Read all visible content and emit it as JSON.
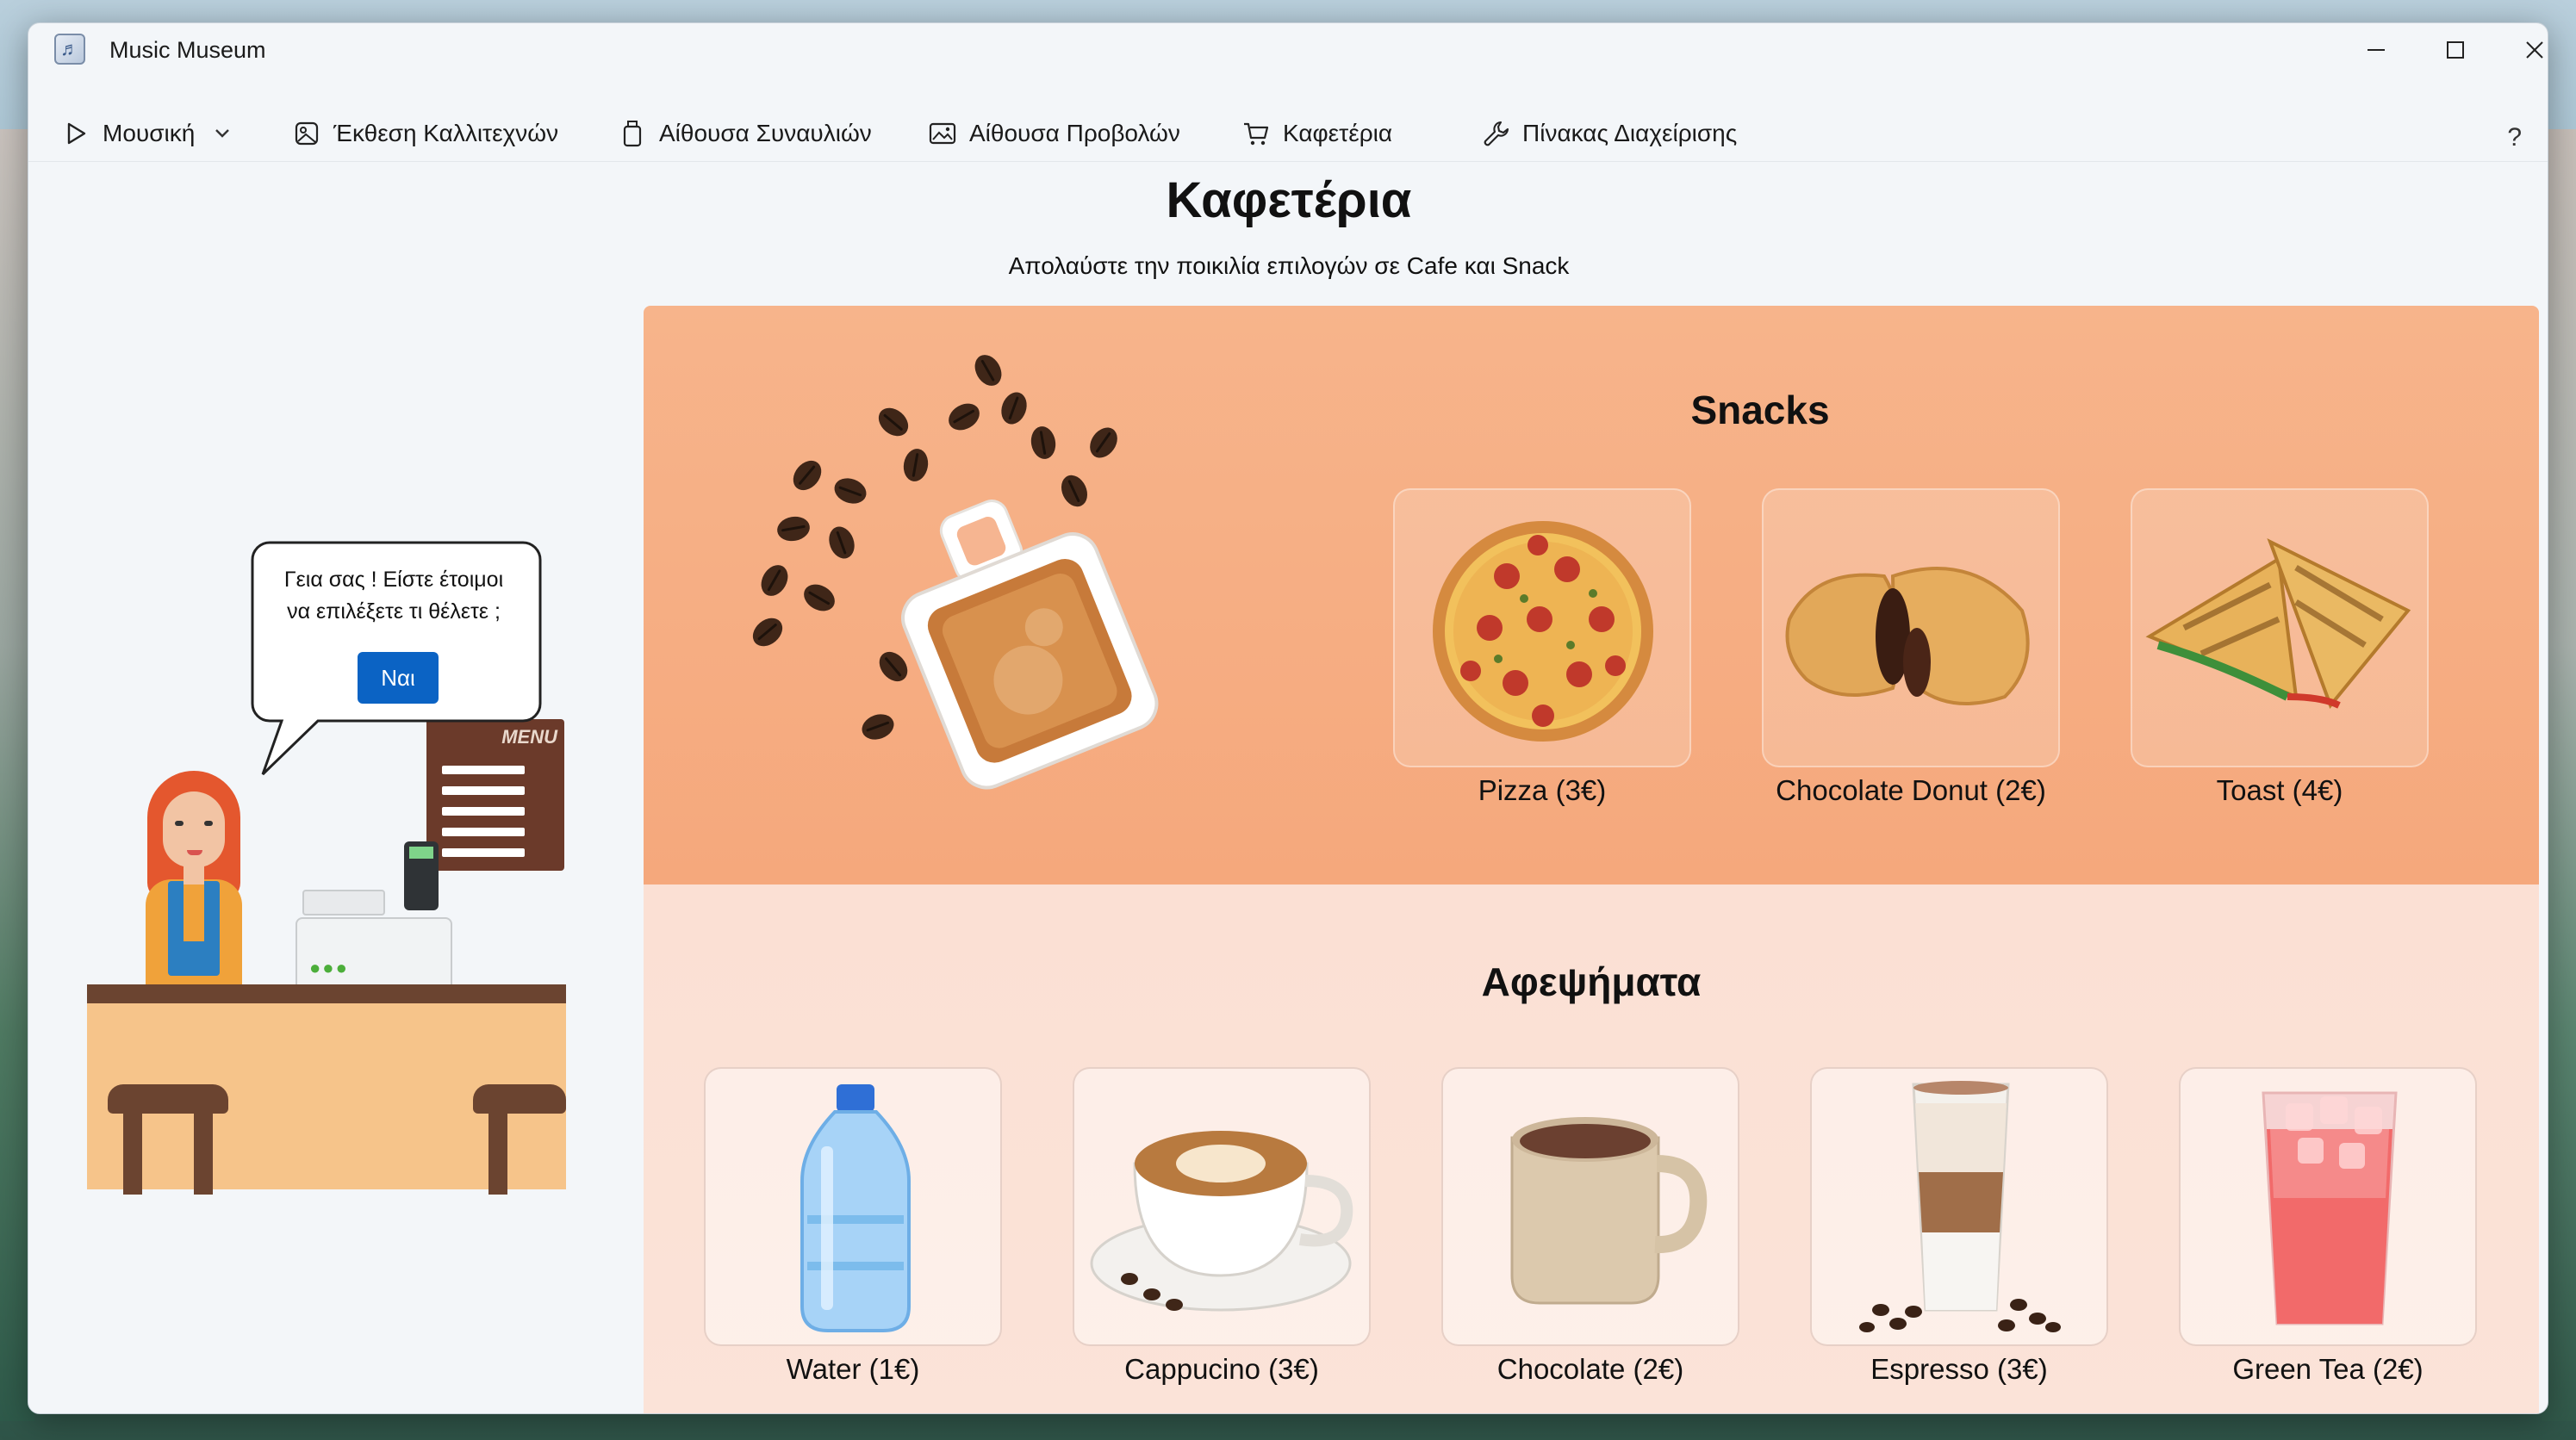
{
  "window": {
    "title": "Music Museum",
    "controls": {
      "minimize": "—",
      "maximize": "☐",
      "close": "✕"
    }
  },
  "nav": {
    "items": [
      {
        "label": "Μουσική",
        "icon": "play-icon"
      },
      {
        "label": "Έκθεση Καλλιτεχνών",
        "icon": "image-icon"
      },
      {
        "label": "Αίθουσα Συναυλιών",
        "icon": "jar-icon"
      },
      {
        "label": "Αίθουσα Προβολών",
        "icon": "gallery-icon"
      },
      {
        "label": "Καφετέρια",
        "icon": "cart-icon",
        "selected": true
      },
      {
        "label": "Πίνακας Διαχείρισης",
        "icon": "wrench-icon"
      }
    ],
    "help": "?"
  },
  "page": {
    "title": "Καφετέρια",
    "subtitle": "Απολαύστε την ποικιλία επιλογών σε Cafe και Snack"
  },
  "greeting": {
    "line1": "Γεια σας ! Είστε έτοιμοι",
    "line2": "να επιλέξετε τι θέλετε ;",
    "button": "Ναι",
    "menu_board": "MENU"
  },
  "snacks": {
    "title": "Snacks",
    "items": [
      {
        "label": "Pizza (3€)",
        "icon": "pizza-icon"
      },
      {
        "label": "Chocolate Donut (2€)",
        "icon": "donut-icon"
      },
      {
        "label": "Toast (4€)",
        "icon": "toast-icon"
      }
    ]
  },
  "drinks": {
    "title": "Αφεψήματα",
    "items": [
      {
        "label": "Water (1€)",
        "icon": "water-bottle-icon"
      },
      {
        "label": "Cappucino (3€)",
        "icon": "cappuccino-icon"
      },
      {
        "label": "Chocolate (2€)",
        "icon": "hot-chocolate-icon"
      },
      {
        "label": "Espresso (3€)",
        "icon": "latte-glass-icon"
      },
      {
        "label": "Green Tea (2€)",
        "icon": "iced-tea-icon"
      }
    ]
  },
  "colors": {
    "accent": "#1f6fd0",
    "snacks_panel": "#f5a87c",
    "drinks_panel": "#fbe0d4",
    "button": "#0b63c4"
  }
}
